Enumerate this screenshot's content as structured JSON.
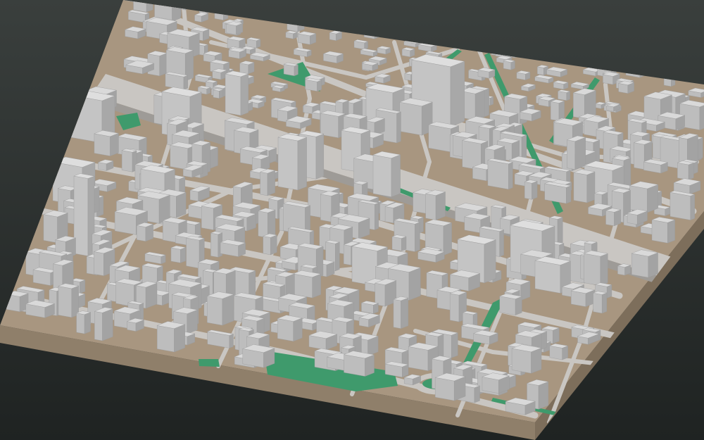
{
  "scene": {
    "kind": "3d-city-block-model",
    "view": "isometric-oblique",
    "colors": {
      "background_top": "#3a3f3d",
      "background_bottom": "#1f2322",
      "ground": "#a89680",
      "ground_edge_front": "#8f7f6a",
      "ground_edge_side": "#7d6e5b",
      "road": "#c9c6c2",
      "green_space": "#3f9a6c",
      "building_top": "#d9d9d9",
      "building_left": "#bdbdbd",
      "building_right": "#a3a3a3",
      "tower_top": "#dedede",
      "tower_left": "#c4c4c4",
      "tower_right": "#a8a8a8"
    },
    "notable_features": [
      "elevated-rail-corridor",
      "tree-lined-avenue",
      "roundabout",
      "riverside-park",
      "tall-tower-cluster"
    ]
  }
}
